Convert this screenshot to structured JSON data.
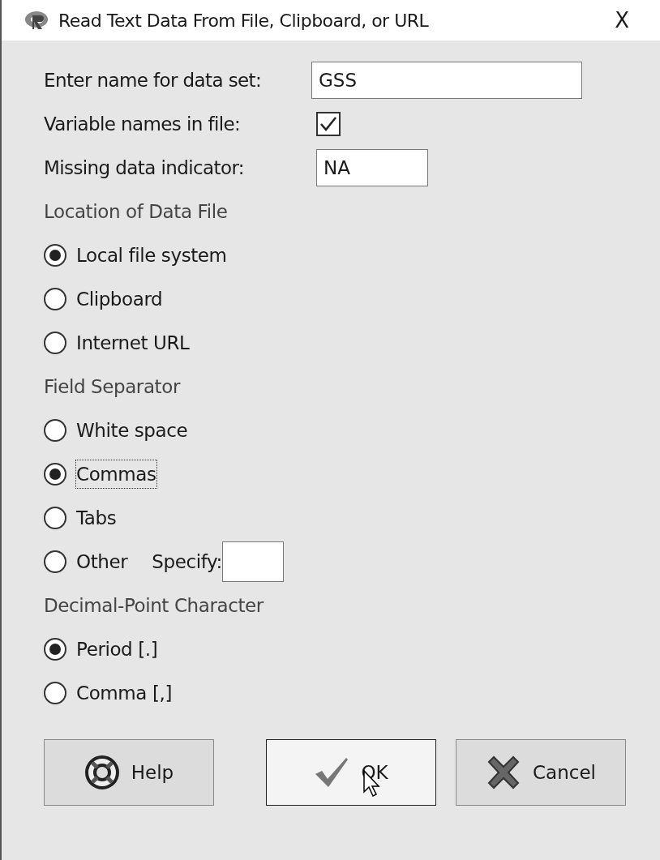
{
  "window": {
    "title": "Read Text Data From File, Clipboard, or URL",
    "close": "X"
  },
  "fields": [
    {
      "label": "Enter name for data set:",
      "kind": "text",
      "value": "GSS"
    },
    {
      "label": "Variable names in file:",
      "kind": "checkbox",
      "checked": true
    },
    {
      "label": "Missing data indicator:",
      "kind": "short",
      "value": "NA"
    }
  ],
  "groups": [
    {
      "title": "Location of Data File",
      "options": [
        {
          "label": "Local file system",
          "selected": true,
          "focused": false
        },
        {
          "label": "Clipboard",
          "selected": false,
          "focused": false
        },
        {
          "label": "Internet URL",
          "selected": false,
          "focused": false
        }
      ]
    },
    {
      "title": "Field Separator",
      "options": [
        {
          "label": "White space",
          "selected": false,
          "focused": false
        },
        {
          "label": "Commas",
          "selected": true,
          "focused": true
        },
        {
          "label": "Tabs",
          "selected": false,
          "focused": false
        },
        {
          "label": "Other",
          "selected": false,
          "focused": false,
          "specify": {
            "label": "Specify:"
          }
        }
      ]
    },
    {
      "title": "Decimal-Point Character",
      "options": [
        {
          "label": "Period [.]",
          "selected": true,
          "focused": false
        },
        {
          "label": "Comma [,]",
          "selected": false,
          "focused": false
        }
      ]
    }
  ],
  "buttons": [
    {
      "label": "Help",
      "kind": "help",
      "hovered": false
    },
    {
      "label": "OK",
      "kind": "ok",
      "hovered": true
    },
    {
      "label": "Cancel",
      "kind": "cancel",
      "hovered": false
    }
  ]
}
